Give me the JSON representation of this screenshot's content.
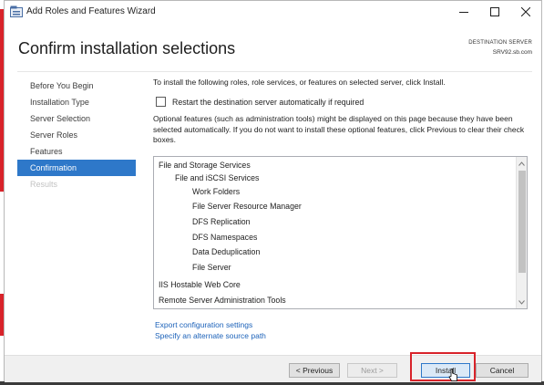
{
  "window": {
    "title": "Add Roles and Features Wizard",
    "icon": "server-manager-icon"
  },
  "header": {
    "page_title": "Confirm installation selections",
    "destination_label": "DESTINATION SERVER",
    "destination_server": "SRV92.sb.com"
  },
  "nav": {
    "items": [
      {
        "label": "Before You Begin",
        "state": "normal"
      },
      {
        "label": "Installation Type",
        "state": "normal"
      },
      {
        "label": "Server Selection",
        "state": "normal"
      },
      {
        "label": "Server Roles",
        "state": "normal"
      },
      {
        "label": "Features",
        "state": "normal"
      },
      {
        "label": "Confirmation",
        "state": "active"
      },
      {
        "label": "Results",
        "state": "disabled"
      }
    ]
  },
  "content": {
    "intro": "To install the following roles, role services, or features on selected server, click Install.",
    "restart_label": "Restart the destination server automatically if required",
    "restart_checked": false,
    "optional_text": "Optional features (such as administration tools) might be displayed on this page because they have been selected automatically. If you do not want to install these optional features, click Previous to clear their check boxes."
  },
  "selections": [
    "File and Storage Services",
    "File and iSCSI Services",
    "Work Folders",
    "File Server Resource Manager",
    "DFS Replication",
    "DFS Namespaces",
    "Data Deduplication",
    "File Server",
    "IIS Hostable Web Core",
    "Remote Server Administration Tools"
  ],
  "links": {
    "export": "Export configuration settings",
    "alternate_source": "Specify an alternate source path"
  },
  "buttons": {
    "previous": "< Previous",
    "next": "Next >",
    "install": "Install",
    "cancel": "Cancel"
  },
  "colors": {
    "accent": "#2e78c9",
    "highlight_box": "#d8232a",
    "link": "#1c62b9"
  }
}
